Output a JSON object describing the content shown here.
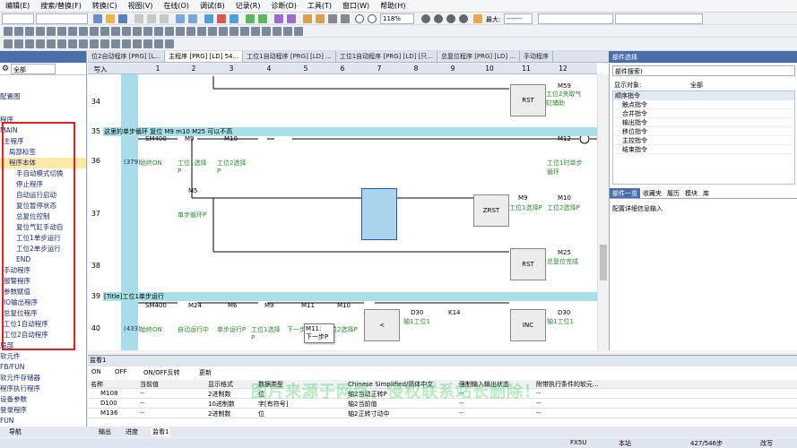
{
  "menu": [
    "编辑(E)",
    "搜索/替换(F)",
    "转换(C)",
    "视图(V)",
    "在线(O)",
    "调试(B)",
    "记录(R)",
    "诊断(D)",
    "工具(T)",
    "窗口(W)",
    "帮助(H)"
  ],
  "toolbar": {
    "zoom": "118%",
    "max_label": "最大:",
    "max_value": "-------"
  },
  "tabs": [
    "位2自动程序 [PRG] [L...",
    "主程序 [PRG] [LD] 54...",
    "工位1自动程序 [PRG] [LD] ...",
    "工位1自动程序 [PRG] [LD] [只...",
    "总复位程序 [PRG] [LD] ...",
    "手动程序"
  ],
  "right_panel": {
    "title": "部件选择",
    "search_placeholder": "部件搜索)",
    "display_label": "显示对象:",
    "display_value": "全部",
    "items": [
      "顺序指令",
      "触点指令",
      "合并指令",
      "输出指令",
      "移位指令",
      "主控指令",
      "结束指令"
    ],
    "bottom_tabs": [
      "部件一览",
      "收藏夹",
      "履历",
      "模块",
      "库"
    ],
    "detail_label": "配置详细信息输入"
  },
  "nav": {
    "header": "导航",
    "filter": "全部",
    "items": [
      "配置图",
      "程序",
      "MAIN",
      "主程序",
      "局部标签",
      "程序本体",
      "手自动模式切换",
      "停止程序",
      "自动运行启动",
      "复位暂停状态",
      "总复位控制",
      "复位气缸手动自",
      "工位1单步运行",
      "工位2单步运行",
      "END",
      "手动程序",
      "报警程序",
      "参数赋值",
      "IO输出程序",
      "总复位程序",
      "工位1自动程序",
      "工位2自动程序",
      "局部",
      "软元件",
      "FB/FUN",
      "软元件存储器",
      "程序执行程序",
      "设备参数",
      "登录程序",
      "FUN"
    ]
  },
  "ladder": {
    "write_label": "写入",
    "columns": [
      "1",
      "2",
      "3",
      "4",
      "5",
      "6",
      "7",
      "8",
      "9",
      "10",
      "11",
      "12"
    ],
    "steps": {
      "s34": "34",
      "s35": "35",
      "s36": "36",
      "s37": "37",
      "s38": "38",
      "s39": "39",
      "s40": "40"
    },
    "comment35": "这里的单步循环 复位 M9 m10 M25 可以不高",
    "comment39": "[Title]工位1单步运行",
    "r34": {
      "cmd": "RST",
      "coil": "M59",
      "coil_cmt": "工位2夹取气缸辅助"
    },
    "r36": {
      "stepnum": "(379)",
      "c1": "SM400",
      "c1_cmt": "始终ON",
      "c2": "M9",
      "c2_cmt": "工位1选择P",
      "c3": "M10",
      "c3_cmt": "工位2选择P",
      "coil": "M12",
      "coil_cmt": "工位1时单步循环"
    },
    "r37": {
      "c1": "M5",
      "c1_cmt": "单步循环P",
      "cmd": "ZRST",
      "a1": "M9",
      "a1_cmt": "工位1选择P",
      "a2": "M10",
      "a2_cmt": "工位2选择P"
    },
    "r38": {
      "cmd": "RST",
      "coil": "M25",
      "coil_cmt": "总复位完成"
    },
    "r40": {
      "stepnum": "(433)",
      "c1": "SM400",
      "c1_cmt": "始终ON",
      "c2": "M24",
      "c2_cmt": "自动运行中",
      "c3": "M6",
      "c3_cmt": "单步运行P",
      "c4": "M9",
      "c4_cmt": "工位1选择P",
      "c5": "M11",
      "c5_cmt": "下一步P",
      "c6": "M10",
      "c6_cmt": "工位2选择P",
      "cmp": "<",
      "d1": "D30",
      "d1_cmt": "轴1工位1",
      "d2": "K14",
      "cmd": "INC",
      "d3": "D30",
      "d3_cmt": "轴1工位1"
    },
    "tooltip": [
      "M11:",
      "下一步P"
    ]
  },
  "watch": {
    "title": "监看1",
    "buttons": [
      "ON",
      "OFF",
      "ON/OFF反转",
      "更新"
    ],
    "headers": [
      "名称",
      "当前值",
      "显示格式",
      "数据类型",
      "Chinese Simplified/简体中文",
      "强制输入输出状态",
      "附带执行条件的软元..."
    ],
    "rows": [
      [
        "M108",
        "--",
        "2进制数",
        "位",
        "轴2当动正转P",
        "--",
        "--"
      ],
      [
        "D100",
        "--",
        "10进制数",
        "字[有符号]",
        "轴2当前值",
        "--",
        "--"
      ],
      [
        "M136",
        "--",
        "2进制数",
        "位",
        "轴2正转寸动中",
        "--",
        "--"
      ]
    ]
  },
  "bottom_tabs": [
    "导航",
    "输出",
    "进度",
    "监看1"
  ],
  "statusbar": {
    "cpu": "FX5U",
    "station": "本站",
    "steps": "427/546步",
    "mode": "改写"
  },
  "watermark": "图片来源于网络，侵权联系站长删除！",
  "colors": {
    "accent": "#4a6ea9",
    "rail": "#a8dce8",
    "red_box": "#e02020",
    "green_text": "#2a8a2a"
  }
}
